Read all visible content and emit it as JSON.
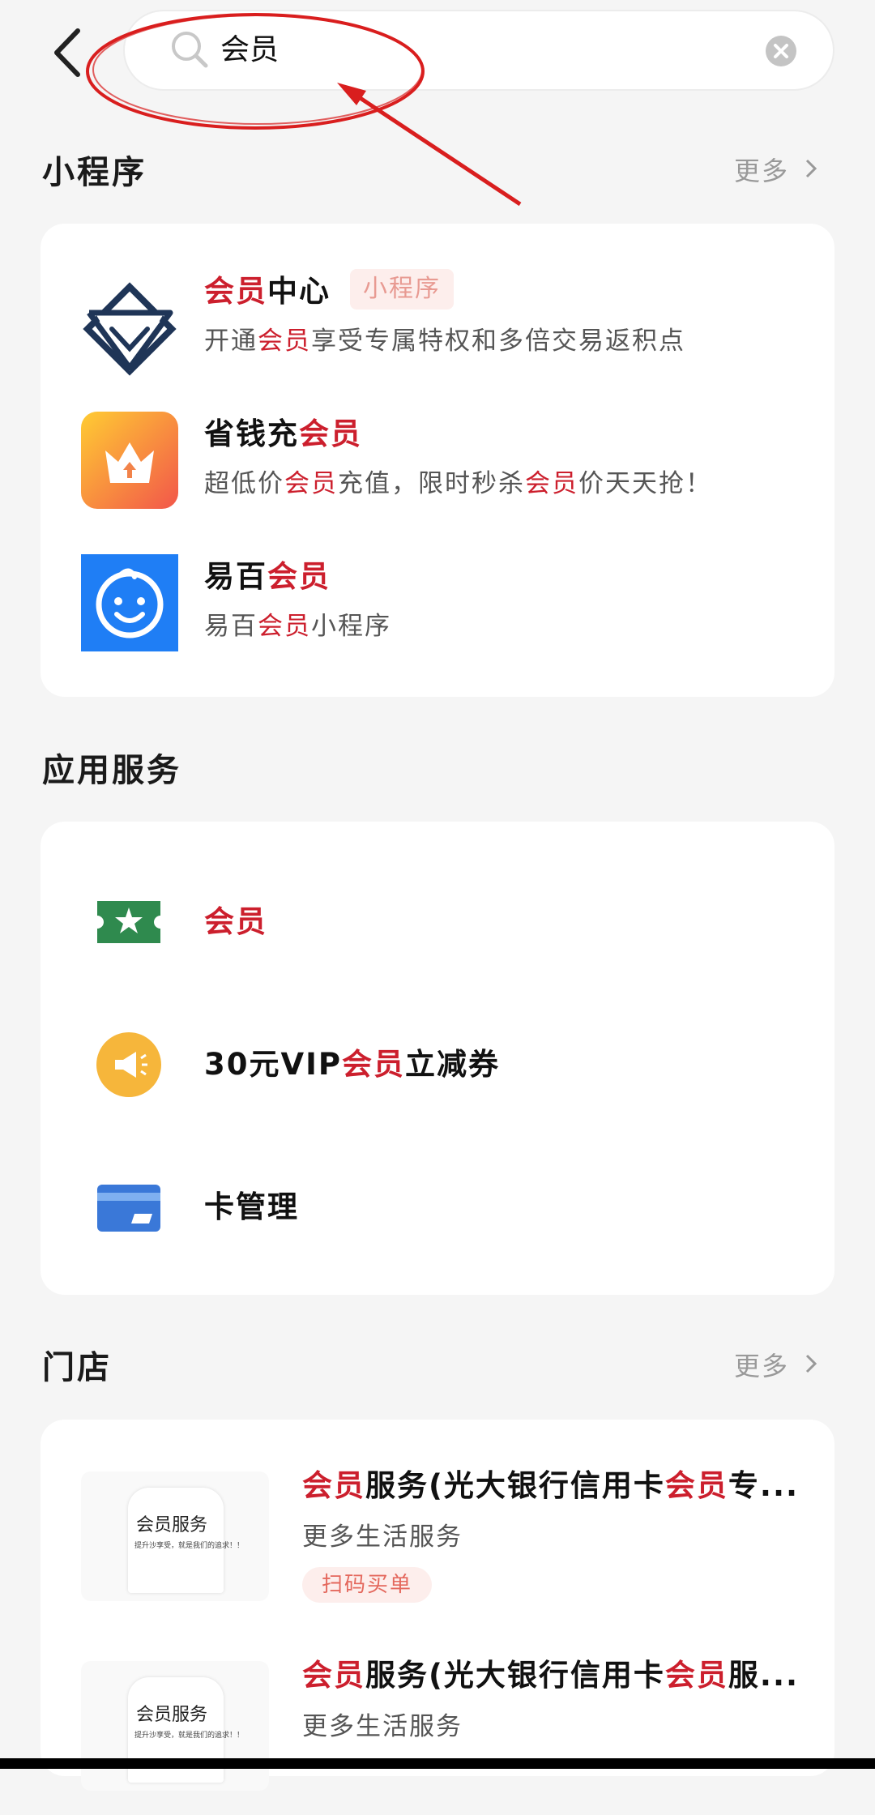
{
  "search": {
    "query": "会员"
  },
  "mini_programs": {
    "section_title": "小程序",
    "more_label": "更多",
    "items": [
      {
        "title_parts": [
          {
            "text": "会员",
            "hl": true
          },
          {
            "text": "中心",
            "hl": false
          }
        ],
        "tag": "小程序",
        "desc_parts": [
          {
            "text": "开通",
            "hl": false
          },
          {
            "text": "会员",
            "hl": true
          },
          {
            "text": "享受专属特权和多倍交易返积点",
            "hl": false
          }
        ],
        "icon": "diamond-chevron-icon"
      },
      {
        "title_parts": [
          {
            "text": "省钱充",
            "hl": false
          },
          {
            "text": "会员",
            "hl": true
          }
        ],
        "desc_parts": [
          {
            "text": "超低价",
            "hl": false
          },
          {
            "text": "会员",
            "hl": true
          },
          {
            "text": "充值，限时秒杀",
            "hl": false
          },
          {
            "text": "会员",
            "hl": true
          },
          {
            "text": "价天天抢！",
            "hl": false
          }
        ],
        "icon": "crown-icon"
      },
      {
        "title_parts": [
          {
            "text": "易百",
            "hl": false
          },
          {
            "text": "会员",
            "hl": true
          }
        ],
        "desc_parts": [
          {
            "text": "易百",
            "hl": false
          },
          {
            "text": "会员",
            "hl": true
          },
          {
            "text": "小程序",
            "hl": false
          }
        ],
        "icon": "baby-face-icon"
      }
    ]
  },
  "app_services": {
    "section_title": "应用服务",
    "items": [
      {
        "label_parts": [
          {
            "text": "会员",
            "hl": true
          }
        ],
        "icon": "star-ticket-icon"
      },
      {
        "label_parts": [
          {
            "text": "30元VIP",
            "hl": false
          },
          {
            "text": "会员",
            "hl": true
          },
          {
            "text": "立减券",
            "hl": false
          }
        ],
        "icon": "megaphone-icon"
      },
      {
        "label_parts": [
          {
            "text": "卡管理",
            "hl": false
          }
        ],
        "icon": "bank-card-icon"
      }
    ]
  },
  "stores": {
    "section_title": "门店",
    "more_label": "更多",
    "items": [
      {
        "title_parts": [
          {
            "text": "会员",
            "hl": true
          },
          {
            "text": "服务(光大银行信用卡",
            "hl": false
          },
          {
            "text": "会员",
            "hl": true
          },
          {
            "text": "专...",
            "hl": false
          }
        ],
        "subtitle": "更多生活服务",
        "tag": "扫码买单",
        "thumb_title": "会员服务",
        "thumb_sub": "提升沙享受，就是我们的追求！！"
      },
      {
        "title_parts": [
          {
            "text": "会员",
            "hl": true
          },
          {
            "text": "服务(光大银行信用卡",
            "hl": false
          },
          {
            "text": "会员",
            "hl": true
          },
          {
            "text": "服...",
            "hl": false
          }
        ],
        "subtitle": "更多生活服务",
        "thumb_title": "会员服务",
        "thumb_sub": "提升沙享受，就是我们的追求！！"
      }
    ]
  },
  "colors": {
    "highlight": "#cc1f2d",
    "background": "#f5f5f5",
    "annotation": "#d91e1e"
  }
}
